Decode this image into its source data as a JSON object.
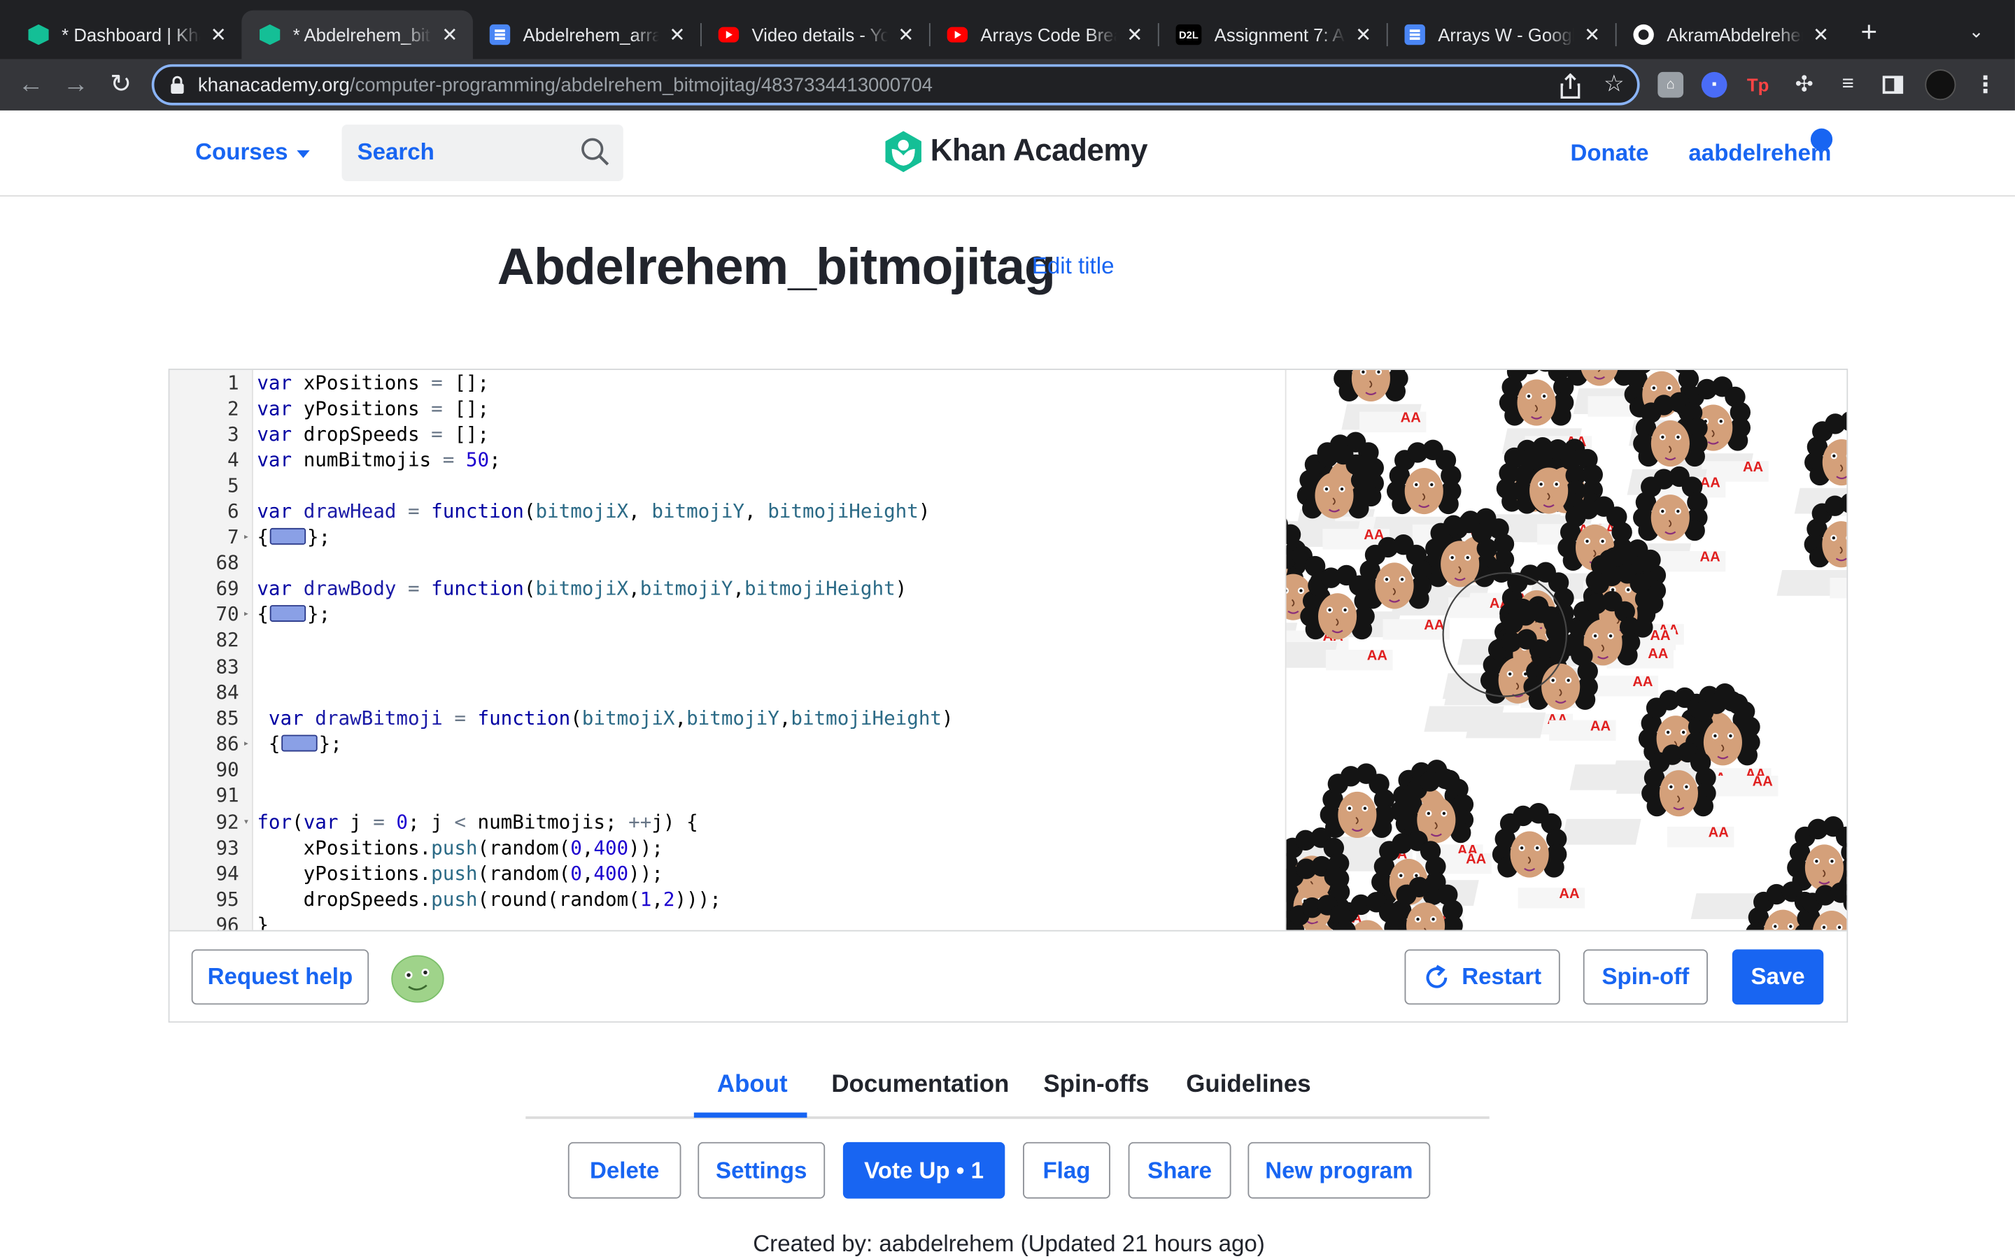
{
  "browser": {
    "tabs": [
      {
        "label": "* Dashboard | Kha",
        "icon": "khan-academy-icon"
      },
      {
        "label": "* Abdelrehem_bit",
        "icon": "khan-academy-icon"
      },
      {
        "label": "Abdelrehem_arra",
        "icon": "google-docs-icon"
      },
      {
        "label": "Video details - Yo",
        "icon": "youtube-icon"
      },
      {
        "label": "Arrays Code Brea",
        "icon": "youtube-icon"
      },
      {
        "label": "Assignment 7: Ar",
        "icon": "d2l-icon"
      },
      {
        "label": "Arrays W - Googl",
        "icon": "google-docs-icon"
      },
      {
        "label": "AkramAbdelrehen",
        "icon": "github-icon"
      }
    ],
    "d2l_badge": "D2L",
    "url_host": "khanacademy.org",
    "url_path": "/computer-programming/abdelrehem_bitmojitag/4837334413000704",
    "extension_tp": "Tp"
  },
  "header": {
    "courses": "Courses",
    "search_placeholder": "Search",
    "logo_text": "Khan Academy",
    "donate": "Donate",
    "username": "aabdelrehem"
  },
  "program": {
    "title": "Abdelrehem_bitmojitag",
    "edit_title": "Edit title"
  },
  "editor": {
    "line_numbers": [
      "1",
      "2",
      "3",
      "4",
      "5",
      "6",
      "7",
      "68",
      "69",
      "70",
      "82",
      "83",
      "84",
      "85",
      "86",
      "90",
      "91",
      "92",
      "93",
      "94",
      "95",
      "96"
    ],
    "canvas_label": "AA"
  },
  "editor_footer": {
    "request_help": "Request help",
    "restart": "Restart",
    "spinoff": "Spin-off",
    "save": "Save"
  },
  "info_tabs": [
    "About",
    "Documentation",
    "Spin-offs",
    "Guidelines"
  ],
  "actions": [
    "Delete",
    "Settings",
    "Vote Up • 1",
    "Flag",
    "Share",
    "New program"
  ],
  "created_by": "Created by: aabdelrehem (Updated 21 hours ago)",
  "colors": {
    "accent": "#1865f2",
    "ka_green": "#14bf96",
    "chrome_dark": "#202124"
  }
}
